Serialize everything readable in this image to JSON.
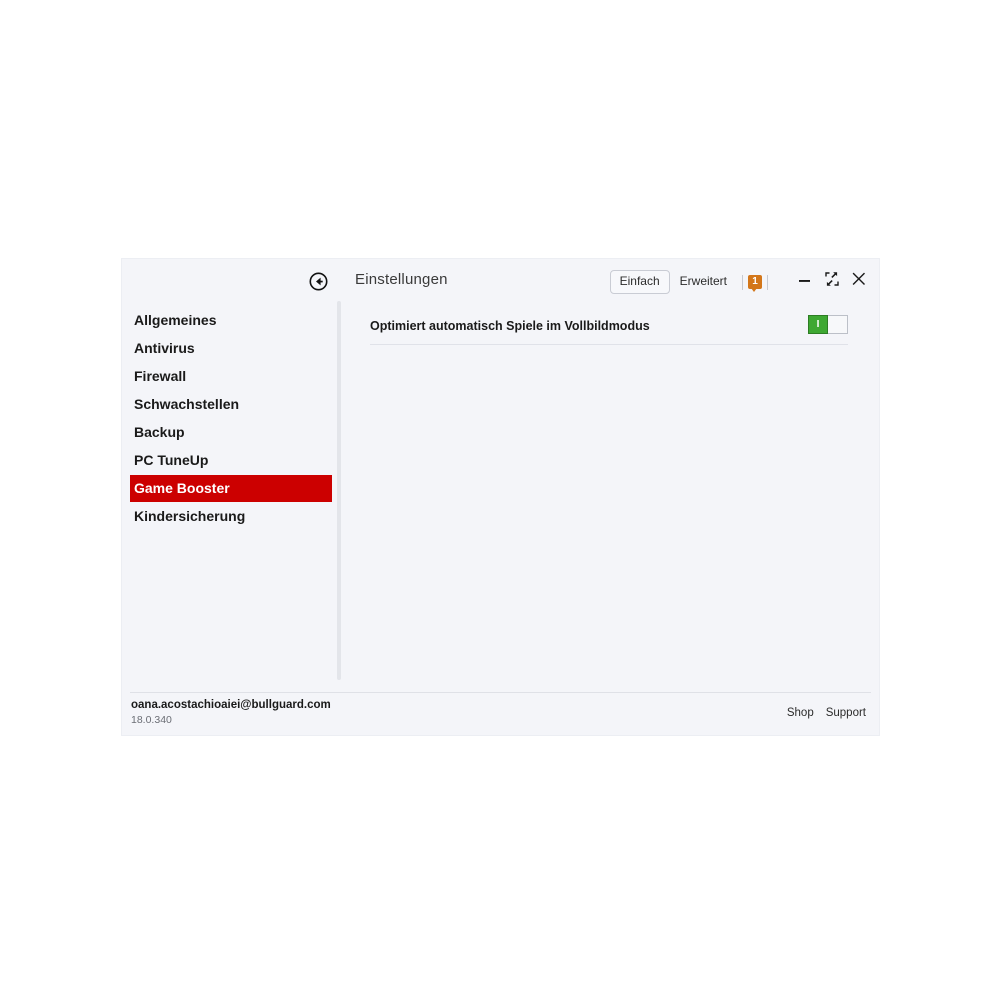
{
  "window": {
    "title": "Einstellungen",
    "back_icon": "circle-back-arrow-icon"
  },
  "header": {
    "mode_simple": "Einfach",
    "mode_advanced": "Erweitert",
    "notification_count": "1",
    "minimize_icon": "minimize-icon",
    "restore_icon": "restore-down-icon",
    "close_icon": "close-icon"
  },
  "sidebar": {
    "items": [
      {
        "label": "Allgemeines",
        "selected": false
      },
      {
        "label": "Antivirus",
        "selected": false
      },
      {
        "label": "Firewall",
        "selected": false
      },
      {
        "label": "Schwachstellen",
        "selected": false
      },
      {
        "label": "Backup",
        "selected": false
      },
      {
        "label": "PC TuneUp",
        "selected": false
      },
      {
        "label": "Game Booster",
        "selected": true
      },
      {
        "label": "Kindersicherung",
        "selected": false
      }
    ]
  },
  "content": {
    "settings": [
      {
        "label": "Optimiert automatisch Spiele im Vollbildmodus",
        "toggle_state": "on",
        "toggle_on_glyph": "I"
      }
    ]
  },
  "footer": {
    "email": "oana.acostachioaiei@bullguard.com",
    "version": "18.0.340",
    "shop_label": "Shop",
    "support_label": "Support"
  },
  "colors": {
    "accent_red": "#cc0000",
    "toggle_green": "#3ea832",
    "badge_orange": "#d3761a",
    "window_bg": "#f4f5f9"
  }
}
